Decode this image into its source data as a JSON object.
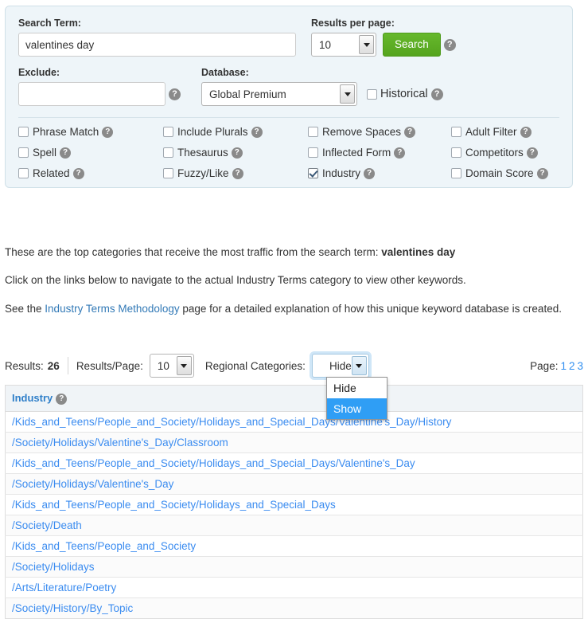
{
  "search_form": {
    "search_term_label": "Search Term:",
    "search_term_value": "valentines day",
    "search_term_placeholder": "",
    "results_per_page_label": "Results per page:",
    "results_per_page_value": "10",
    "search_button_label": "Search",
    "exclude_label": "Exclude:",
    "exclude_value": "",
    "exclude_placeholder": "",
    "database_label": "Database:",
    "database_value": "Global Premium",
    "historical_label": "Historical",
    "help_icon": "help-icon",
    "options": [
      {
        "label": "Phrase Match",
        "checked": false
      },
      {
        "label": "Include Plurals",
        "checked": false
      },
      {
        "label": "Remove Spaces",
        "checked": false
      },
      {
        "label": "Adult Filter",
        "checked": false
      },
      {
        "label": "Spell",
        "checked": false
      },
      {
        "label": "Thesaurus",
        "checked": false
      },
      {
        "label": "Inflected Form",
        "checked": false
      },
      {
        "label": "Competitors",
        "checked": false
      },
      {
        "label": "Related",
        "checked": false
      },
      {
        "label": "Fuzzy/Like",
        "checked": false
      },
      {
        "label": "Industry",
        "checked": true
      },
      {
        "label": "Domain Score",
        "checked": false
      }
    ]
  },
  "description": {
    "line1_prefix": "These are the top categories that receive the most traffic from the search term: ",
    "line1_term": "valentines day",
    "line2": "Click on the links below to navigate to the actual Industry Terms category to view other keywords.",
    "line3_prefix": "See the ",
    "line3_link": "Industry Terms Methodology",
    "line3_suffix": " page for a detailed explanation of how this unique keyword database is created."
  },
  "results_toolbar": {
    "results_label": "Results:",
    "results_count": "26",
    "results_per_page_label": "Results/Page:",
    "results_per_page_value": "10",
    "regional_categories_label": "Regional Categories:",
    "regional_categories_value": "Hide",
    "regional_options": [
      "Hide",
      "Show"
    ],
    "regional_selected_option": "Show",
    "page_label": "Page:",
    "pages": [
      "1",
      "2",
      "3"
    ]
  },
  "table": {
    "header": "Industry",
    "rows": [
      "/Kids_and_Teens/People_and_Society/Holidays_and_Special_Days/Valentine's_Day/History",
      "/Society/Holidays/Valentine's_Day/Classroom",
      "/Kids_and_Teens/People_and_Society/Holidays_and_Special_Days/Valentine's_Day",
      "/Society/Holidays/Valentine's_Day",
      "/Kids_and_Teens/People_and_Society/Holidays_and_Special_Days",
      "/Society/Death",
      "/Kids_and_Teens/People_and_Society",
      "/Society/Holidays",
      "/Arts/Literature/Poetry",
      "/Society/History/By_Topic"
    ]
  },
  "colors": {
    "panel_bg": "#eef5f9",
    "search_button": "#5cb024",
    "link": "#3b8cf0",
    "header_link": "#2f7fc9",
    "dropdown_highlight": "#2f9ef5"
  }
}
